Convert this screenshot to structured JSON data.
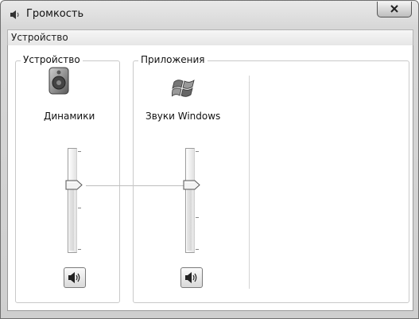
{
  "window": {
    "title": "Громкость",
    "menu": [
      "Устройство"
    ]
  },
  "device": {
    "group_label": "Устройство",
    "name": "Динамики",
    "icon": "speaker-icon",
    "volume_percent": 67,
    "muted": false
  },
  "apps": {
    "group_label": "Приложения",
    "items": [
      {
        "name": "Звуки Windows",
        "icon": "windows-flag-icon",
        "volume_percent": 67,
        "muted": false
      }
    ]
  }
}
